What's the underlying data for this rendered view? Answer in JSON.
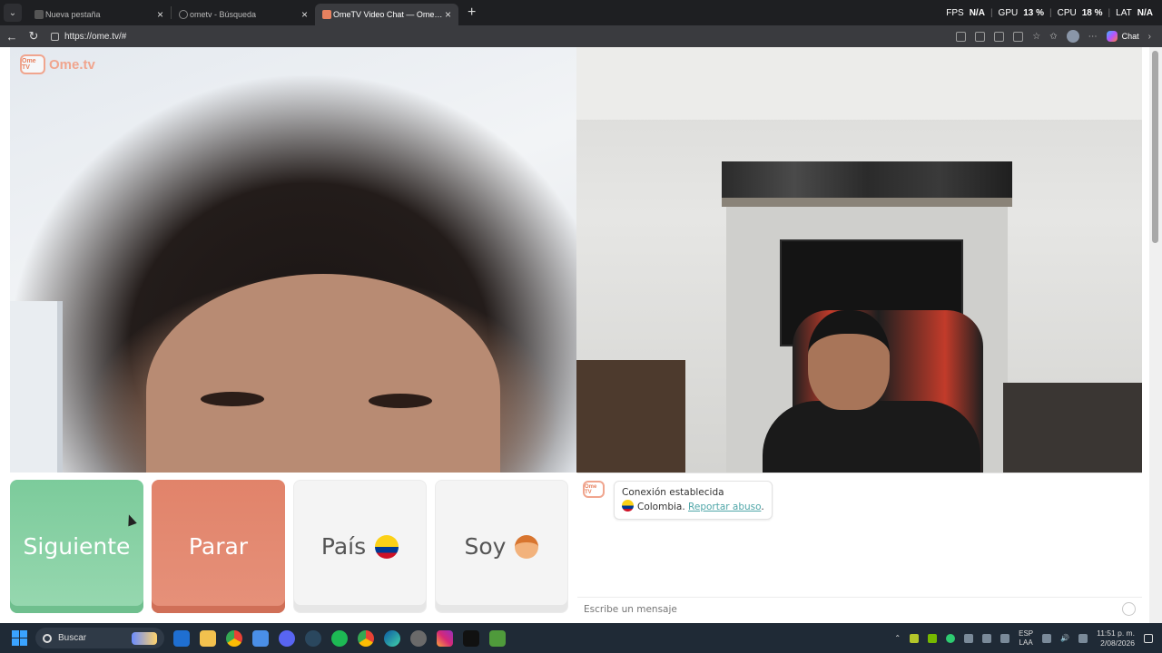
{
  "browser": {
    "tabs": [
      {
        "title": "Nueva pestaña",
        "active": false
      },
      {
        "title": "ometv - Búsqueda",
        "active": false
      },
      {
        "title": "OmeTV Video Chat — Omegle",
        "active": true
      }
    ],
    "new_tab_icon": "plus-icon",
    "url": "https://ome.tv/#",
    "chat_label": "Chat",
    "stats": {
      "fps_label": "FPS",
      "fps_value": "N/A",
      "gpu_label": "GPU",
      "gpu_value": "13 %",
      "cpu_label": "CPU",
      "cpu_value": "18 %",
      "lat_label": "LAT",
      "lat_value": "N/A"
    }
  },
  "app": {
    "logo_badge": "Ome TV",
    "logo_text": "Ome.tv",
    "brand_color": "#f0a58e",
    "buttons": {
      "next": "Siguiente",
      "stop": "Parar",
      "country": "País",
      "gender": "Soy"
    },
    "colors": {
      "next": "#7ccb9b",
      "stop": "#e1836a"
    },
    "country_flag_icon": "colombia-flag-icon",
    "gender_icon": "boy-emoji-icon"
  },
  "chat": {
    "system_message": {
      "title": "Conexión establecida",
      "country": "Colombia.",
      "report_link": "Reportar abuso",
      "trailing": "."
    },
    "input_placeholder": "Escribe un mensaje",
    "emoji_icon": "smiley-icon"
  },
  "taskbar": {
    "search_label": "Buscar",
    "language_top": "ESP",
    "language_bottom": "LAA",
    "time": "11:51 p. m.",
    "date": "2/08/2026"
  }
}
